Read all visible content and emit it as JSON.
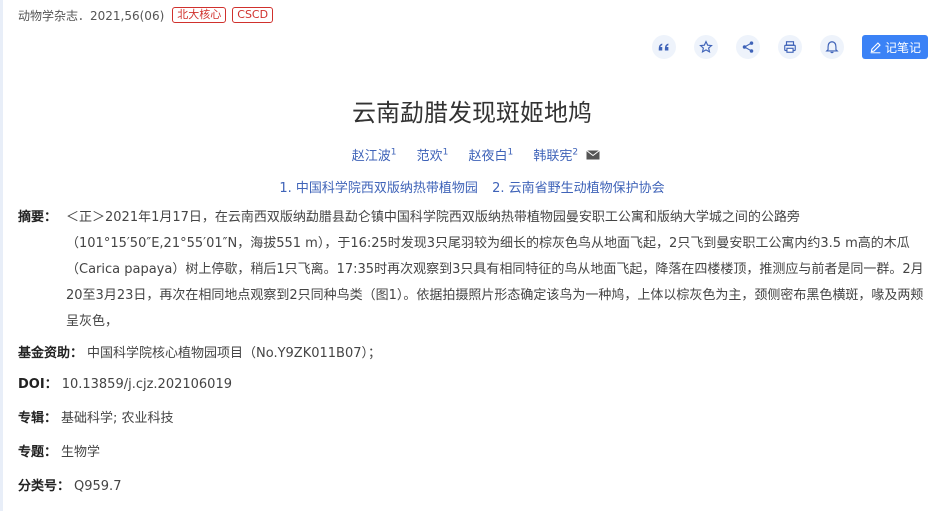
{
  "journal": {
    "source": "动物学杂志．2021,56(06)",
    "tags": [
      "北大核心",
      "CSCD"
    ]
  },
  "actions": {
    "note_label": "记笔记"
  },
  "article": {
    "title": "云南勐腊发现斑姬地鸠",
    "authors": [
      {
        "name": "赵江波",
        "sup": "1"
      },
      {
        "name": "范欢",
        "sup": "1"
      },
      {
        "name": "赵夜白",
        "sup": "1"
      },
      {
        "name": "韩联宪",
        "sup": "2"
      }
    ],
    "affiliations": [
      "1. 中国科学院西双版纳热带植物园",
      "2. 云南省野生动植物保护协会"
    ],
    "abstract_label": "摘要：",
    "abstract": "＜正＞2021年1月17日，在云南西双版纳勐腊县勐仑镇中国科学院西双版纳热带植物园曼安职工公寓和版纳大学城之间的公路旁（101°15′50″E,21°55′01″N，海拔551 m），于16:25时发现3只尾羽较为细长的棕灰色鸟从地面飞起，2只飞到曼安职工公寓内约3.5 m高的木瓜（Carica papaya）树上停歇，稍后1只飞离。17:35时再次观察到3只具有相同特征的鸟从地面飞起，降落在四楼楼顶，推测应与前者是同一群。2月20至3月23日，再次在相同地点观察到2只同种鸟类（图1）。依据拍摄照片形态确定该鸟为一种鸠，上体以棕灰色为主，颈侧密布黑色横斑，喙及两颊呈灰色，",
    "fund_label": "基金资助：",
    "fund": "中国科学院核心植物园项目（No.Y9ZK011B07）；",
    "doi_label": "DOI：",
    "doi": "10.13859/j.cjz.202106019",
    "album_label": "专辑：",
    "album": "基础科学; 农业科技",
    "topic_label": "专题：",
    "topic": "生物学",
    "class_label": "分类号：",
    "class_no": "Q959.7"
  }
}
